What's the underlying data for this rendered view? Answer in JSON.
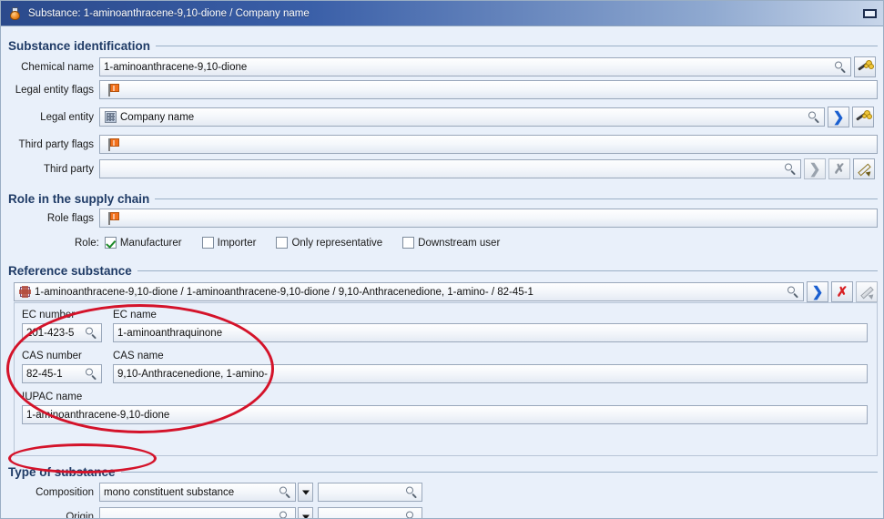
{
  "window": {
    "title": "Substance: 1-aminoanthracene-9,10-dione / Company name",
    "icon": "flask-icon",
    "minimize_label": "",
    "title_bar_color": "#2b4a8c",
    "background_color": "#e9f0fa"
  },
  "sections": {
    "substance_identification": {
      "title": "Substance identification",
      "rows": [
        {
          "label": "Chemical name",
          "value": "1-aminoanthracene-9,10-dione"
        },
        {
          "label": "Legal entity flags",
          "value": ""
        },
        {
          "label": "Legal entity",
          "value": "Company name"
        },
        {
          "label": "Third party flags",
          "value": ""
        },
        {
          "label": "Third party",
          "value": ""
        }
      ]
    },
    "role_in_supply_chain": {
      "title": "Role in the supply chain",
      "role_flags_label": "Role flags",
      "role_label": "Role:",
      "checkboxes": [
        {
          "label": "Manufacturer",
          "checked": true
        },
        {
          "label": "Importer",
          "checked": false
        },
        {
          "label": "Only representative",
          "checked": false
        },
        {
          "label": "Downstream user",
          "checked": false
        }
      ]
    },
    "reference_substance": {
      "title": "Reference substance",
      "selected": "1-aminoanthracene-9,10-dione / 1-aminoanthracene-9,10-dione / 9,10-Anthracenedione, 1-amino- / 82-45-1",
      "fields": [
        {
          "label": "EC number",
          "value": "201-423-5"
        },
        {
          "label": "EC name",
          "value": "1-aminoanthraquinone"
        },
        {
          "label": "CAS number",
          "value": "82-45-1"
        },
        {
          "label": "CAS name",
          "value": "9,10-Anthracenedione, 1-amino-"
        },
        {
          "label": "IUPAC name",
          "value": "1-aminoanthracene-9,10-dione"
        }
      ]
    },
    "type_of_substance": {
      "title": "Type of substance",
      "rows": [
        {
          "label": "Composition",
          "value": "mono constituent substance",
          "secondary_value": ""
        },
        {
          "label": "Origin",
          "value": "",
          "secondary_value": ""
        }
      ]
    }
  },
  "annotations": {
    "color": "#d4132a",
    "ellipses": [
      {
        "name": "reference-substance-highlight"
      },
      {
        "name": "type-of-substance-highlight"
      }
    ]
  },
  "icons": {
    "search": "magnifier-icon",
    "flag": "flag-icon",
    "building": "building-icon",
    "wand": "magic-wand-icon",
    "arrow": "chevron-right-icon",
    "delete": "x-delete-icon",
    "pencil": "pencil-icon",
    "dropdown": "chevron-down-icon"
  }
}
